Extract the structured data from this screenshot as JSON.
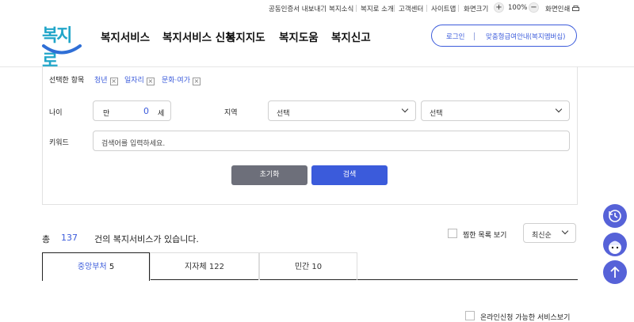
{
  "utility_bar": {
    "links": [
      "공동인증서 내보내기",
      "복지소식",
      "복지로 소개",
      "고객센터",
      "사이트맵"
    ],
    "zoom_label": "화면크기",
    "zoom_in": "+",
    "zoom_value": "100%",
    "zoom_out": "−",
    "print_label": "화면인쇄"
  },
  "header": {
    "logo_text": "복지로",
    "nav": [
      "복지서비스",
      "복지서비스 신청",
      "복지지도",
      "복지도움",
      "복지신고"
    ],
    "login": "로그인",
    "custom_benefit": "맞춤형급여안내(복지멤버십)"
  },
  "filter": {
    "selected_label": "선택한 항목",
    "selected_chips": [
      "청년",
      "일자리",
      "문화·여가"
    ],
    "chip_remove": "×",
    "age_label": "나이",
    "age_prefix": "만",
    "age_value": "0",
    "age_unit": "세",
    "region_label": "지역",
    "region_select_1": "선택",
    "region_select_2": "선택",
    "keyword_label": "키워드",
    "keyword_placeholder": "검색어를 입력하세요.",
    "reset_button": "초기화",
    "search_button": "검색"
  },
  "results": {
    "total_prefix": "총",
    "total_count": "137",
    "total_suffix": "건의 복지서비스가 있습니다.",
    "bookmark_view": "찜한 목록 보기",
    "sort_value": "최신순",
    "tabs": [
      {
        "label": "중앙부처",
        "count": "5"
      },
      {
        "label": "지자체",
        "count": "122"
      },
      {
        "label": "민간",
        "count": "10"
      }
    ],
    "online_only": "온라인신청 가능한 서비스보기"
  },
  "colors": {
    "primary": "#3b5bdb",
    "reset_gray": "#6d6f7a",
    "logo_teal": "#22a6c9",
    "float_purple": "#5662d8"
  }
}
